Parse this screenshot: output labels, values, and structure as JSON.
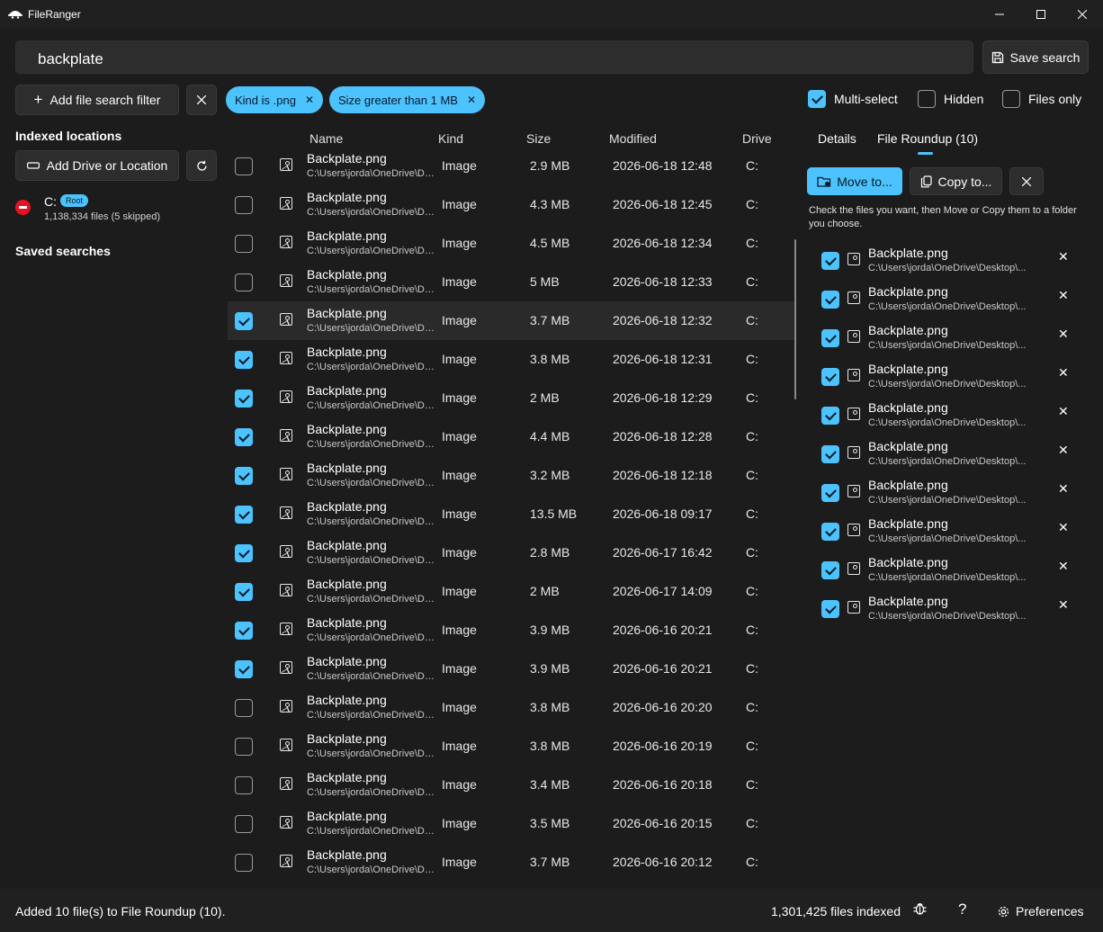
{
  "window": {
    "title": "FileRanger",
    "minimize_icon": "minimize-icon",
    "maximize_icon": "maximize-icon",
    "close_icon": "close-icon"
  },
  "search": {
    "query": "backplate",
    "save_label": "Save search"
  },
  "filters": {
    "add_label": "Add file search filter",
    "chips": [
      {
        "label": "Kind is .png"
      },
      {
        "label": "Size greater than 1 MB"
      }
    ]
  },
  "options": {
    "multi_select": {
      "label": "Multi-select",
      "checked": true
    },
    "hidden": {
      "label": "Hidden",
      "checked": false
    },
    "files_only": {
      "label": "Files only",
      "checked": false
    }
  },
  "sidebar": {
    "indexed_heading": "Indexed locations",
    "add_drive_label": "Add Drive or Location",
    "location": {
      "drive": "C:",
      "badge": "Root",
      "count": "1,138,334 files (5 skipped)"
    },
    "saved_heading": "Saved searches"
  },
  "columns": {
    "name": "Name",
    "kind": "Kind",
    "size": "Size",
    "modified": "Modified",
    "drive": "Drive"
  },
  "rows": [
    {
      "name": "Backplate.png",
      "path": "C:\\Users\\jorda\\OneDrive\\Desktop",
      "kind": "Image",
      "size": "2.9 MB",
      "modified": "2026-06-18 12:48",
      "drive": "C:",
      "checked": false
    },
    {
      "name": "Backplate.png",
      "path": "C:\\Users\\jorda\\OneDrive\\Desktop",
      "kind": "Image",
      "size": "4.3 MB",
      "modified": "2026-06-18 12:45",
      "drive": "C:",
      "checked": false
    },
    {
      "name": "Backplate.png",
      "path": "C:\\Users\\jorda\\OneDrive\\Desktop",
      "kind": "Image",
      "size": "4.5 MB",
      "modified": "2026-06-18 12:34",
      "drive": "C:",
      "checked": false
    },
    {
      "name": "Backplate.png",
      "path": "C:\\Users\\jorda\\OneDrive\\Desktop",
      "kind": "Image",
      "size": "5 MB",
      "modified": "2026-06-18 12:33",
      "drive": "C:",
      "checked": false
    },
    {
      "name": "Backplate.png",
      "path": "C:\\Users\\jorda\\OneDrive\\Desktop",
      "kind": "Image",
      "size": "3.7 MB",
      "modified": "2026-06-18 12:32",
      "drive": "C:",
      "checked": true
    },
    {
      "name": "Backplate.png",
      "path": "C:\\Users\\jorda\\OneDrive\\Desktop",
      "kind": "Image",
      "size": "3.8 MB",
      "modified": "2026-06-18 12:31",
      "drive": "C:",
      "checked": true
    },
    {
      "name": "Backplate.png",
      "path": "C:\\Users\\jorda\\OneDrive\\Desktop",
      "kind": "Image",
      "size": "2 MB",
      "modified": "2026-06-18 12:29",
      "drive": "C:",
      "checked": true
    },
    {
      "name": "Backplate.png",
      "path": "C:\\Users\\jorda\\OneDrive\\Desktop",
      "kind": "Image",
      "size": "4.4 MB",
      "modified": "2026-06-18 12:28",
      "drive": "C:",
      "checked": true
    },
    {
      "name": "Backplate.png",
      "path": "C:\\Users\\jorda\\OneDrive\\Desktop",
      "kind": "Image",
      "size": "3.2 MB",
      "modified": "2026-06-18 12:18",
      "drive": "C:",
      "checked": true
    },
    {
      "name": "Backplate.png",
      "path": "C:\\Users\\jorda\\OneDrive\\Desktop",
      "kind": "Image",
      "size": "13.5 MB",
      "modified": "2026-06-18 09:17",
      "drive": "C:",
      "checked": true
    },
    {
      "name": "Backplate.png",
      "path": "C:\\Users\\jorda\\OneDrive\\Desktop",
      "kind": "Image",
      "size": "2.8 MB",
      "modified": "2026-06-17 16:42",
      "drive": "C:",
      "checked": true
    },
    {
      "name": "Backplate.png",
      "path": "C:\\Users\\jorda\\OneDrive\\Desktop",
      "kind": "Image",
      "size": "2 MB",
      "modified": "2026-06-17 14:09",
      "drive": "C:",
      "checked": true
    },
    {
      "name": "Backplate.png",
      "path": "C:\\Users\\jorda\\OneDrive\\Desktop",
      "kind": "Image",
      "size": "3.9 MB",
      "modified": "2026-06-16 20:21",
      "drive": "C:",
      "checked": true
    },
    {
      "name": "Backplate.png",
      "path": "C:\\Users\\jorda\\OneDrive\\Desktop",
      "kind": "Image",
      "size": "3.9 MB",
      "modified": "2026-06-16 20:21",
      "drive": "C:",
      "checked": true
    },
    {
      "name": "Backplate.png",
      "path": "C:\\Users\\jorda\\OneDrive\\Desktop",
      "kind": "Image",
      "size": "3.8 MB",
      "modified": "2026-06-16 20:20",
      "drive": "C:",
      "checked": false
    },
    {
      "name": "Backplate.png",
      "path": "C:\\Users\\jorda\\OneDrive\\Desktop",
      "kind": "Image",
      "size": "3.8 MB",
      "modified": "2026-06-16 20:19",
      "drive": "C:",
      "checked": false
    },
    {
      "name": "Backplate.png",
      "path": "C:\\Users\\jorda\\OneDrive\\Desktop",
      "kind": "Image",
      "size": "3.4 MB",
      "modified": "2026-06-16 20:18",
      "drive": "C:",
      "checked": false
    },
    {
      "name": "Backplate.png",
      "path": "C:\\Users\\jorda\\OneDrive\\Desktop",
      "kind": "Image",
      "size": "3.5 MB",
      "modified": "2026-06-16 20:15",
      "drive": "C:",
      "checked": false
    },
    {
      "name": "Backplate.png",
      "path": "C:\\Users\\jorda\\OneDrive\\Desktop",
      "kind": "Image",
      "size": "3.7 MB",
      "modified": "2026-06-16 20:12",
      "drive": "C:",
      "checked": false
    }
  ],
  "right_panel": {
    "tabs": [
      {
        "label": "Details"
      },
      {
        "label": "File Roundup (10)"
      }
    ],
    "move_label": "Move to...",
    "copy_label": "Copy to...",
    "help": "Check the files you want, then Move or Copy them to a folder you choose.",
    "items": [
      {
        "name": "Backplate.png",
        "path": "C:\\Users\\jorda\\OneDrive\\Desktop\\..."
      },
      {
        "name": "Backplate.png",
        "path": "C:\\Users\\jorda\\OneDrive\\Desktop\\..."
      },
      {
        "name": "Backplate.png",
        "path": "C:\\Users\\jorda\\OneDrive\\Desktop\\..."
      },
      {
        "name": "Backplate.png",
        "path": "C:\\Users\\jorda\\OneDrive\\Desktop\\..."
      },
      {
        "name": "Backplate.png",
        "path": "C:\\Users\\jorda\\OneDrive\\Desktop\\..."
      },
      {
        "name": "Backplate.png",
        "path": "C:\\Users\\jorda\\OneDrive\\Desktop\\..."
      },
      {
        "name": "Backplate.png",
        "path": "C:\\Users\\jorda\\OneDrive\\Desktop\\..."
      },
      {
        "name": "Backplate.png",
        "path": "C:\\Users\\jorda\\OneDrive\\Desktop\\..."
      },
      {
        "name": "Backplate.png",
        "path": "C:\\Users\\jorda\\OneDrive\\Desktop\\..."
      },
      {
        "name": "Backplate.png",
        "path": "C:\\Users\\jorda\\OneDrive\\Desktop\\..."
      }
    ]
  },
  "status": {
    "message": "Added 10 file(s) to File Roundup (10).",
    "indexed": "1,301,425 files indexed",
    "help_glyph": "?",
    "preferences_label": "Preferences"
  },
  "colors": {
    "accent": "#4cc2ff",
    "background": "#1c1c1c",
    "panel": "#2d2d2d",
    "error": "#e81123"
  }
}
